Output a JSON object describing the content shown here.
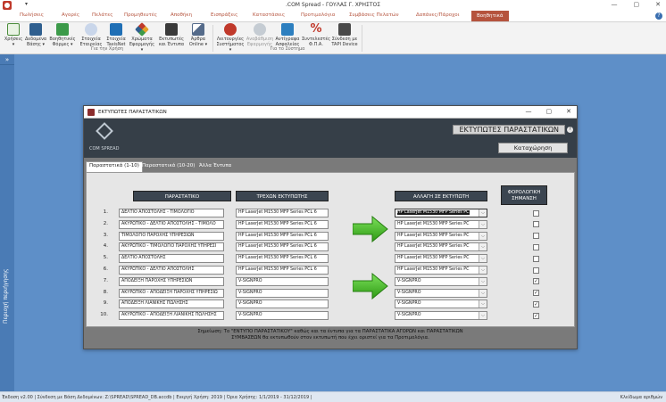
{
  "window": {
    "title": ".COM Spread - ΓΟΥΛΑΣ Γ. ΧΡΗΣΤΟΣ",
    "quick_access": "▾",
    "controls": [
      "—",
      "▢",
      "✕"
    ]
  },
  "tabs": [
    {
      "label": "Πωλήσεις"
    },
    {
      "label": "Αγορές"
    },
    {
      "label": "Πελάτες"
    },
    {
      "label": "Προμηθευτές"
    },
    {
      "label": "Αποθήκη"
    },
    {
      "label": "Εισπράξεις"
    },
    {
      "label": "Καταστάσεις"
    },
    {
      "label": "Προτιμολόγια"
    },
    {
      "label": "Συμβάσεις Πελατών"
    },
    {
      "label": "Δαπάνες/Πάροχοι"
    },
    {
      "label": "Βοηθητικά"
    }
  ],
  "help_icon": "?",
  "ribbon": {
    "buttons": [
      {
        "label1": "Χρήσεις",
        "label2": "▾",
        "icon": "calendar-icon",
        "color": "#4a8c3a"
      },
      {
        "label1": "Δεδομένα",
        "label2": "Βάσης ▾",
        "icon": "database-icon",
        "color": "#2f5f8f"
      },
      {
        "label1": "Βοηθητικές",
        "label2": "Φόρμες ▾",
        "icon": "forms-icon",
        "color": "#3c9a4a"
      },
      {
        "label1": "Στοιχεία",
        "label2": "Εταιρείας",
        "icon": "company-icon",
        "color": "#8aa0c8"
      },
      {
        "label1": "Στοιχεία",
        "label2": "TaxisNet",
        "icon": "taxisnet-icon",
        "color": "#1f6fb5"
      },
      {
        "label1": "Χρώματα",
        "label2": "Εφαρμογής ▾",
        "icon": "palette-icon",
        "color": "#e2a12a"
      },
      {
        "label1": "Εκτυπωτές",
        "label2": "και Έντυπα",
        "icon": "printer-icon",
        "color": "#3a3a3a"
      },
      {
        "label1": "Άρθρα",
        "label2": "Online ▾",
        "icon": "articles-icon",
        "color": "#556b8a"
      },
      {
        "label1": "Λειτουργίες",
        "label2": "Συστήματος ▾",
        "icon": "gear-icon",
        "color": "#c0392b"
      },
      {
        "label1": "Αναβάθμιση",
        "label2": "Εφαρμογής",
        "icon": "upgrade-icon",
        "color": "#9aa5b1"
      },
      {
        "label1": "Αντίγραφα",
        "label2": "Ασφαλείας",
        "icon": "backup-icon",
        "color": "#2d7fbf"
      },
      {
        "label1": "Συντελεστές",
        "label2": "Φ.Π.Α.",
        "icon": "percent-icon",
        "color": "#c0392b"
      },
      {
        "label1": "Σύνδεση με",
        "label2": "TAPI Device",
        "icon": "phone-icon",
        "color": "#4a4a4a"
      }
    ],
    "groups": [
      "Για την Χρήση",
      "Για το Σύστημα"
    ]
  },
  "sidebar": {
    "toggle": "»",
    "label": "Περιοχή περιήγησης"
  },
  "status": {
    "left": "Έκδοση v2.00  |  Σύνδεση με Βάση Δεδομένων: Z:\\SPREAD\\SPREAD_DB.accdb  |  Ενεργή Χρήση: 2019  |  Όρια Χρήσης: 1/1/2019 - 31/12/2019  |",
    "right": "Κλείδωμα αριθμών"
  },
  "dialog": {
    "title": "ΕΚΤΥΠΩΤΕΣ ΠΑΡΑΣΤΑΤΙΚΩΝ",
    "controls": [
      "—",
      "▢",
      "✕"
    ],
    "logo_text": "COM SPREAD",
    "header_title": "ΕΚΤΥΠΩΤΕΣ ΠΑΡΑΣΤΑΤΙΚΩΝ",
    "help": "?",
    "save_label": "Καταχώρηση",
    "tabs": [
      "Παραστατικά (1-10)",
      "Παραστατικά (10-20)",
      "Άλλα Έντυπα"
    ],
    "headers": {
      "document": "ΠΑΡΑΣΤΑΤΙΚΟ",
      "current": "ΤΡΕΧΩΝ ΕΚΤΥΠΩΤΗΣ",
      "change": "ΑΛΛΑΓΗ ΣΕ ΕΚΤΥΠΩΤΗ",
      "fiscal": "ΦΟΡΟΛΟΓΙΚΗ ΣΗΜΑΝΣΗ"
    },
    "rows": [
      {
        "num": "1.",
        "doc": "ΔΕΛΤΙΟ ΑΠΟΣΤΟΛΗΣ - ΤΙΜΟΛΟΓΙΟ",
        "current": "HP LaserJet M1530 MFP Series PCL 6",
        "change": "HP LaserJet M1530 MFP Series PC",
        "checked": false
      },
      {
        "num": "2.",
        "doc": "ΑΚΥΡΩΤΙΚΟ - ΔΕΛΤΙΟ ΑΠΟΣΤΟΛΗΣ - ΤΙΜΟΛΟ",
        "current": "HP LaserJet M1530 MFP Series PCL 6",
        "change": "HP LaserJet M1530 MFP Series PC",
        "checked": false
      },
      {
        "num": "3.",
        "doc": "ΤΙΜΟΛΟΓΙΟ ΠΑΡΟΧΗΣ ΥΠΗΡΕΣΙΩΝ",
        "current": "HP LaserJet M1530 MFP Series PCL 6",
        "change": "HP LaserJet M1530 MFP Series PC",
        "checked": false
      },
      {
        "num": "4.",
        "doc": "ΑΚΥΡΩΤΙΚΟ - ΤΙΜΟΛΟΓΙΟ ΠΑΡΟΧΗΣ ΥΠΗΡΕΣΙ",
        "current": "HP LaserJet M1530 MFP Series PCL 6",
        "change": "HP LaserJet M1530 MFP Series PC",
        "checked": false
      },
      {
        "num": "5.",
        "doc": "ΔΕΛΤΙΟ ΑΠΟΣΤΟΛΗΣ",
        "current": "HP LaserJet M1530 MFP Series PCL 6",
        "change": "HP LaserJet M1530 MFP Series PC",
        "checked": false
      },
      {
        "num": "6.",
        "doc": "ΑΚΥΡΩΤΙΚΟ - ΔΕΛΤΙΟ ΑΠΟΣΤΟΛΗΣ",
        "current": "HP LaserJet M1530 MFP Series PCL 6",
        "change": "HP LaserJet M1530 MFP Series PC",
        "checked": false
      },
      {
        "num": "7.",
        "doc": "ΑΠΟΔΕΙΞΗ ΠΑΡΟΧΗΣ ΥΠΗΡΕΣΙΩΝ",
        "current": "V-SIGNPRO",
        "change": "V-SIGNPRO",
        "checked": true
      },
      {
        "num": "8.",
        "doc": "ΑΚΥΡΩΤΙΚΟ - ΑΠΟΔΕΙΞΗ ΠΑΡΟΧΗΣ ΥΠΗΡΕΣΙΩ",
        "current": "V-SIGNPRO",
        "change": "V-SIGNPRO",
        "checked": true
      },
      {
        "num": "9.",
        "doc": "ΑΠΟΔΕΙΞΗ ΛΙΑΝΙΚΗΣ ΠΩΛΗΣΗΣ",
        "current": "V-SIGNPRO",
        "change": "V-SIGNPRO",
        "checked": true
      },
      {
        "num": "10.",
        "doc": "ΑΚΥΡΩΤΙΚΟ - ΑΠΟΔΕΙΞΗ ΛΙΑΝΙΚΗΣ ΠΩΛΗΣΗΣ",
        "current": "V-SIGNPRO",
        "change": "V-SIGNPRO",
        "checked": true
      }
    ],
    "dropdown_arrow": "⌵",
    "check_mark": "✓",
    "note_line1": "Σημείωση: Το \"ΕΝΤΥΠΟ ΠΑΡΑΣΤΑΤΙΚΟΥ\" καθώς και τα έντυπα για τα ΠΑΡΑΣΤΑΤΙΚΑ ΑΓΟΡΩΝ και ΠΑΡΑΣΤΑΤΙΚΩΝ",
    "note_line2": "ΣΥΜΒΑΣΕΩΝ θα εκτυπωθούν στον εκτυπωτή που έχει οριστεί για τα Προτιμολόγια.",
    "colors": {
      "header_bg": "#363f48",
      "col_header_bg": "#3b4550",
      "arrow_green": "#3fbf1f"
    }
  }
}
